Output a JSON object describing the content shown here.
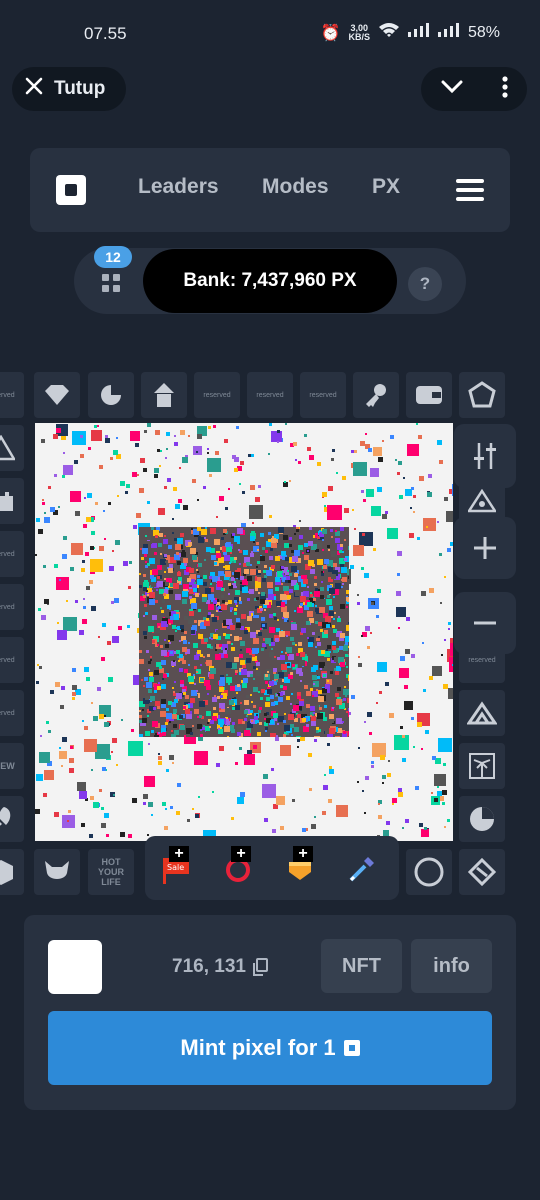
{
  "status_bar": {
    "time": "07.55",
    "speed_value": "3,00",
    "speed_unit": "KB/S",
    "battery": "58%"
  },
  "top": {
    "close_label": "Tutup"
  },
  "nav": {
    "leaders": "Leaders",
    "modes": "Modes",
    "px": "PX"
  },
  "bank": {
    "badge": "12",
    "label": "Bank: 7,437,960 PX",
    "help": "?"
  },
  "board": {
    "tile_labels": [
      "reserved",
      "reserved",
      "reserved",
      "reserved",
      "reserved",
      "reserved",
      "reserved",
      "reserved",
      "CREW",
      "HOT YOUR LIFE"
    ]
  },
  "tools": {
    "plus": "+",
    "sale_text": "Sale"
  },
  "panel": {
    "coords": "716, 131",
    "nft_label": "NFT",
    "info_label": "info",
    "mint_label": "Mint pixel for 1"
  }
}
